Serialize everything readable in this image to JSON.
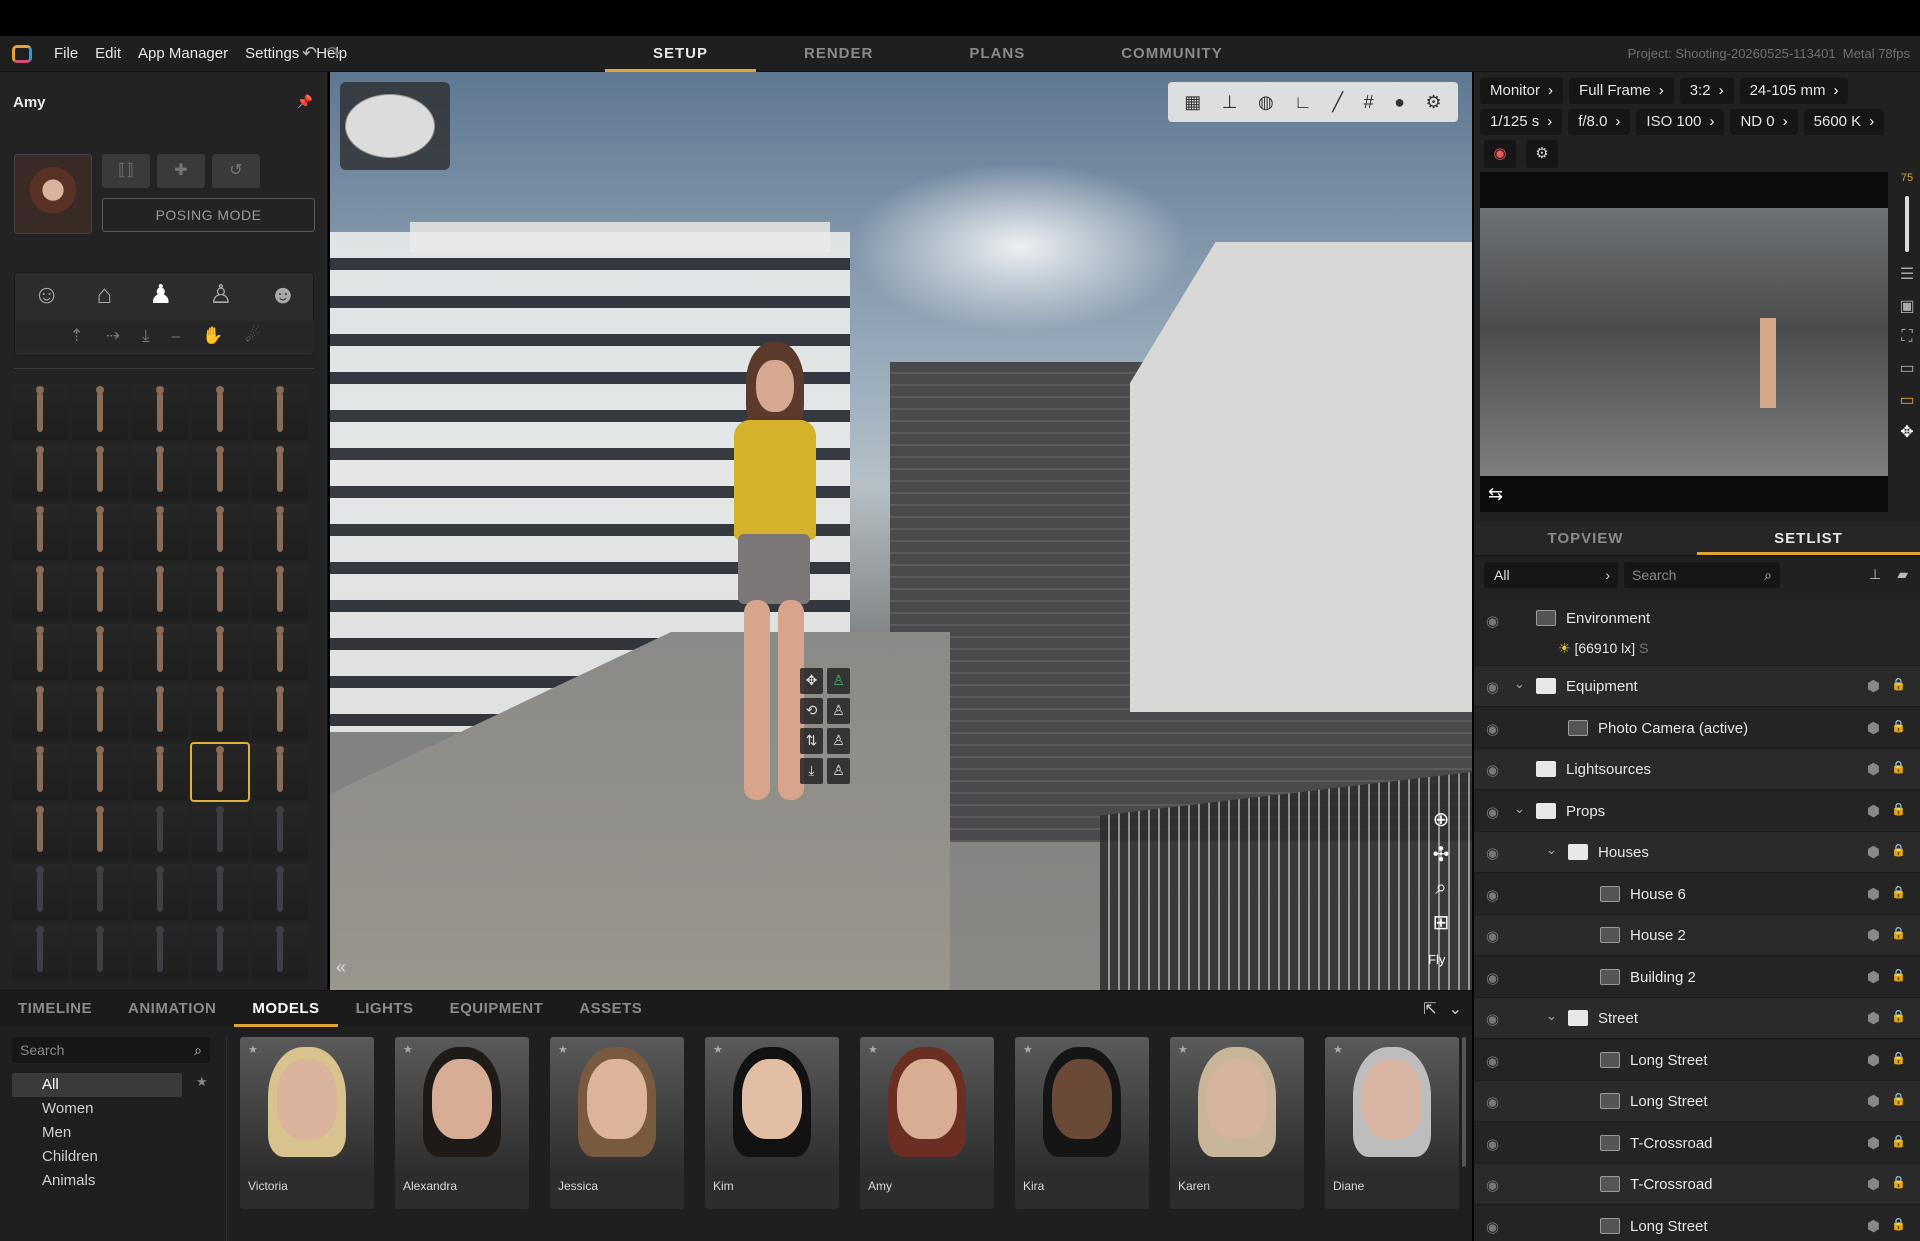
{
  "menubar": {
    "menu": [
      "File",
      "Edit",
      "App Manager",
      "Settings",
      "Help"
    ],
    "tabs": [
      {
        "label": "SETUP",
        "active": true
      },
      {
        "label": "RENDER",
        "active": false
      },
      {
        "label": "PLANS",
        "active": false
      },
      {
        "label": "COMMUNITY",
        "active": false
      }
    ],
    "project": "Project: Shooting-20260525-113401",
    "renderer": "Metal 78fps",
    "accent": "#e0a336"
  },
  "left": {
    "character_name": "Amy",
    "posing_mode_label": "POSING MODE",
    "pose_count": 50,
    "selected_pose_index": 33
  },
  "viewport": {
    "fly_label": "Fly",
    "toolbar_icons": [
      "grid-icon",
      "axes-icon",
      "globe-icon",
      "angle-icon",
      "ruler-icon",
      "hash-grid-icon",
      "bulb-icon",
      "gear-icon"
    ],
    "nav_icons": [
      "orbit-icon",
      "pan-icon",
      "zoom-icon",
      "focus-icon"
    ]
  },
  "camera": {
    "row1": [
      "Monitor",
      "Full Frame",
      "3:2",
      "24-105 mm"
    ],
    "row2": [
      "1/125 s",
      "f/8.0",
      "ISO 100",
      "ND 0",
      "5600 K"
    ],
    "slider_value": "75"
  },
  "right_tabs": [
    {
      "label": "TOPVIEW",
      "active": false
    },
    {
      "label": "SETLIST",
      "active": true
    }
  ],
  "setlist": {
    "filter": "All",
    "search_placeholder": "Search",
    "environment_label": "Environment",
    "environment_lux": "[66910 lx]",
    "environment_s": "S",
    "rows": [
      {
        "label": "Equipment",
        "indent": 0,
        "folder": true,
        "expanded": true
      },
      {
        "label": "Photo Camera (active)",
        "indent": 1,
        "folder": false,
        "expanded": false
      },
      {
        "label": "Lightsources",
        "indent": 0,
        "folder": true,
        "expanded": false
      },
      {
        "label": "Props",
        "indent": 0,
        "folder": true,
        "expanded": true
      },
      {
        "label": "Houses",
        "indent": 1,
        "folder": true,
        "expanded": true
      },
      {
        "label": "House 6",
        "indent": 2,
        "folder": false,
        "expanded": false
      },
      {
        "label": "House 2",
        "indent": 2,
        "folder": false,
        "expanded": false
      },
      {
        "label": "Building 2",
        "indent": 2,
        "folder": false,
        "expanded": false
      },
      {
        "label": "Street",
        "indent": 1,
        "folder": true,
        "expanded": true
      },
      {
        "label": "Long Street",
        "indent": 2,
        "folder": false,
        "expanded": false
      },
      {
        "label": "Long Street",
        "indent": 2,
        "folder": false,
        "expanded": false
      },
      {
        "label": "T-Crossroad",
        "indent": 2,
        "folder": false,
        "expanded": false
      },
      {
        "label": "T-Crossroad",
        "indent": 2,
        "folder": false,
        "expanded": false
      },
      {
        "label": "Long Street",
        "indent": 2,
        "folder": false,
        "expanded": false
      }
    ]
  },
  "bottom": {
    "tabs": [
      {
        "label": "TIMELINE",
        "active": false
      },
      {
        "label": "ANIMATION",
        "active": false
      },
      {
        "label": "MODELS",
        "active": true
      },
      {
        "label": "LIGHTS",
        "active": false
      },
      {
        "label": "EQUIPMENT",
        "active": false
      },
      {
        "label": "ASSETS",
        "active": false
      }
    ],
    "search_placeholder": "Search",
    "categories": [
      {
        "label": "All",
        "active": true
      },
      {
        "label": "Women",
        "active": false
      },
      {
        "label": "Men",
        "active": false
      },
      {
        "label": "Children",
        "active": false
      },
      {
        "label": "Animals",
        "active": false
      }
    ],
    "models": [
      {
        "name": "Victoria",
        "hair": "#d8c28e",
        "skin": "#d9b39c"
      },
      {
        "name": "Alexandra",
        "hair": "#1e1a18",
        "skin": "#d8ad95"
      },
      {
        "name": "Jessica",
        "hair": "#7a5a3e",
        "skin": "#dcb49a"
      },
      {
        "name": "Kim",
        "hair": "#121212",
        "skin": "#e2bfa4"
      },
      {
        "name": "Amy",
        "hair": "#6a2f22",
        "skin": "#d9ad94"
      },
      {
        "name": "Kira",
        "hair": "#151515",
        "skin": "#6a4a36"
      },
      {
        "name": "Karen",
        "hair": "#c8b59a",
        "skin": "#d6b39f"
      },
      {
        "name": "Diane",
        "hair": "#bdbdbd",
        "skin": "#d8b5a2"
      }
    ]
  }
}
